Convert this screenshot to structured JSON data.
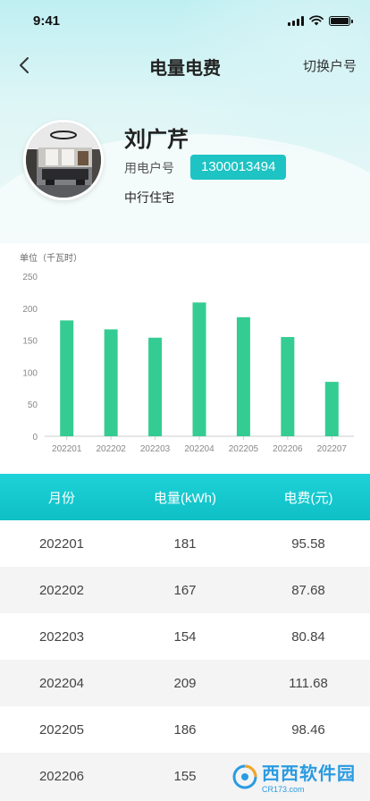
{
  "status": {
    "time": "9:41"
  },
  "nav": {
    "title": "电量电费",
    "switch_label": "切换户号"
  },
  "profile": {
    "name": "刘广芹",
    "account_label": "用电户号",
    "account_number": "1300013494",
    "address": "中行住宅"
  },
  "chart_data": {
    "type": "bar",
    "ylabel": "单位（千瓦时）",
    "categories": [
      "202201",
      "202202",
      "202203",
      "202204",
      "202205",
      "202206",
      "202207"
    ],
    "values": [
      181,
      167,
      154,
      209,
      186,
      155,
      85
    ],
    "ylim": [
      0,
      250
    ],
    "yticks": [
      0,
      50,
      100,
      150,
      200,
      250
    ],
    "bar_color": "#34cc92",
    "grid": false
  },
  "table": {
    "headers": [
      "月份",
      "电量(kWh)",
      "电费(元)"
    ],
    "rows": [
      [
        "202201",
        "181",
        "95.58"
      ],
      [
        "202202",
        "167",
        "87.68"
      ],
      [
        "202203",
        "154",
        "80.84"
      ],
      [
        "202204",
        "209",
        "111.68"
      ],
      [
        "202205",
        "186",
        "98.46"
      ],
      [
        "202206",
        "155",
        ""
      ]
    ]
  },
  "watermark": {
    "text": "西西软件园",
    "sub": "CR173.com"
  },
  "colors": {
    "accent": "#1ec3c3",
    "bar": "#34cc92",
    "header_start": "#1dd2d8",
    "header_end": "#0fc0c6"
  }
}
